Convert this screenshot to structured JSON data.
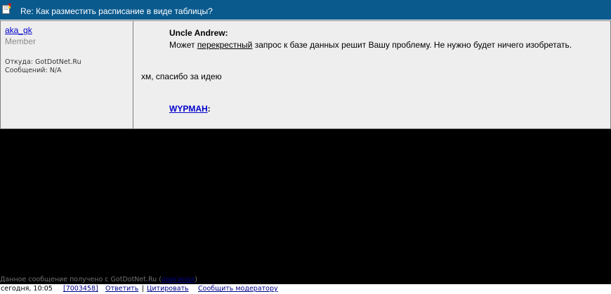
{
  "header": {
    "title": "Re: Как разместить расписание в виде таблицы?",
    "icon": "document-icon"
  },
  "author": {
    "name": "aka_gk",
    "role": "Member",
    "from": "Откуда: GotDotNet.Ru",
    "messages": "Сообщений: N/A"
  },
  "message": {
    "quote_author": "Uncle Andrew:",
    "quote_prefix": "Может ",
    "quote_link": "перекрестный",
    "quote_suffix": " запрос к базе данных решит Вашу проблему. Не нужно будет ничего изобретать.",
    "reply": "хм, спасибо за идею",
    "quote2_author": "WYPMAH",
    "quote2_colon": ":"
  },
  "footer": {
    "source_prefix": "Данное сообщение получено с GotDotNet.Ru (",
    "source_link": "оригинал",
    "source_suffix": ")",
    "date": "сегодня, 10:05",
    "id_link": "[7003458]",
    "reply_link": "Ответить",
    "separator": "|",
    "quote_link": "Цитировать",
    "report_link": "Сообщить модератору"
  },
  "colors": {
    "title_bar": "#0a5a8e",
    "post_bg": "#eeeeee",
    "link": "#0000cc",
    "page_bg": "#000000"
  }
}
